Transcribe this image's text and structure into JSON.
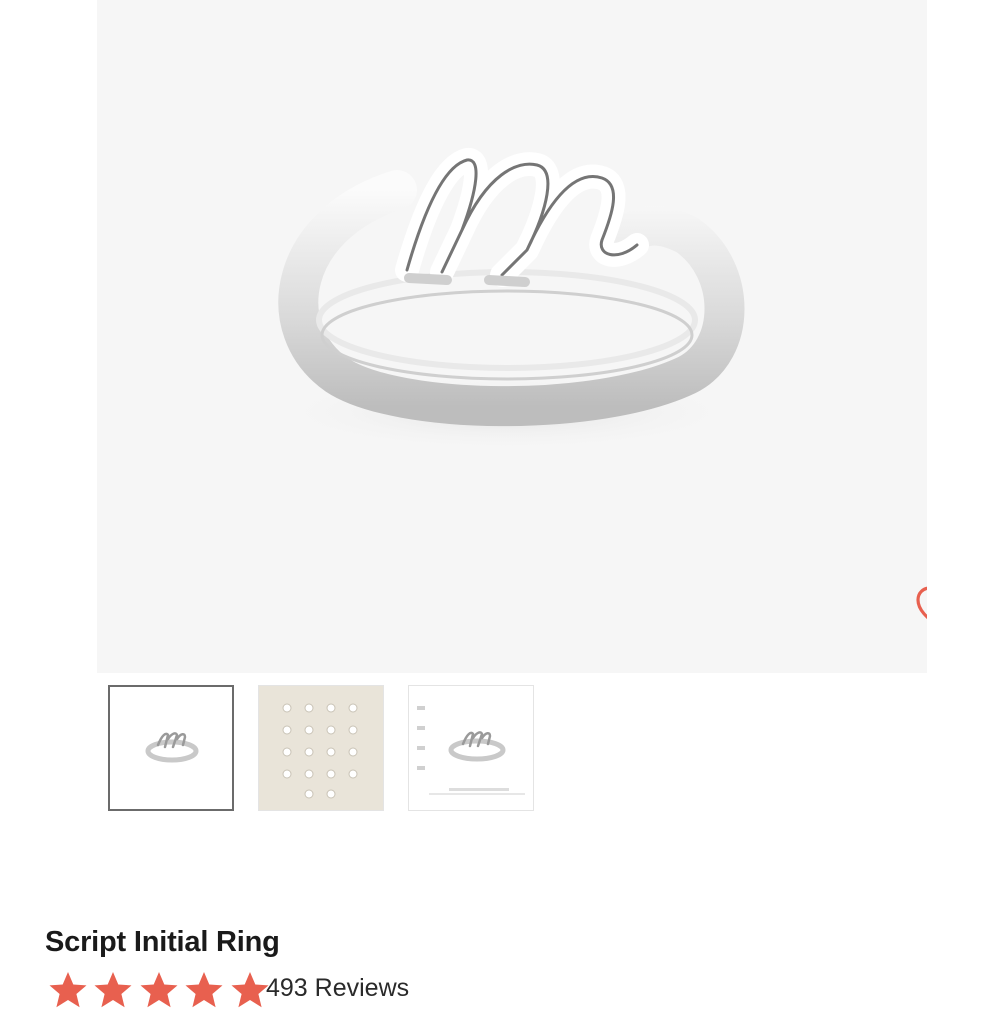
{
  "product": {
    "title": "Script Initial Ring",
    "rating": 5,
    "reviews_label": "493 Reviews"
  },
  "gallery": {
    "hero_icon": "favorite-heart-icon",
    "thumbnails": [
      {
        "name": "ring-side-view",
        "selected": true
      },
      {
        "name": "letter-options-grid",
        "selected": false
      },
      {
        "name": "ring-size-scale",
        "selected": false
      }
    ]
  },
  "colors": {
    "accent": "#e8604f",
    "star": "#e8604f",
    "hero_bg": "#f6f6f6"
  }
}
